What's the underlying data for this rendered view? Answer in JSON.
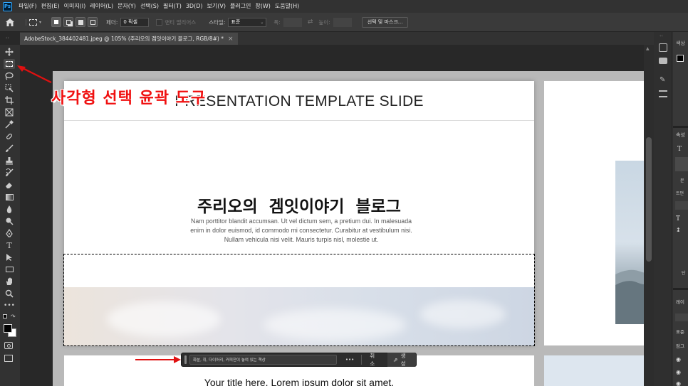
{
  "menubar": {
    "app_icon": "Ps",
    "items": [
      "파일(F)",
      "편집(E)",
      "이미지(I)",
      "레이어(L)",
      "문자(Y)",
      "선택(S)",
      "필터(T)",
      "3D(D)",
      "보기(V)",
      "플러그인",
      "창(W)",
      "도움말(H)"
    ]
  },
  "options": {
    "feather_label": "페더:",
    "feather_value": "0 픽셀",
    "antialias_label": "앤티 앨리어스",
    "style_label": "스타일:",
    "style_value": "표준",
    "width_label": "폭:",
    "height_label": "높이:",
    "select_mask_button": "선택 및 마스크..."
  },
  "document": {
    "tab_title": "AdobeStock_384402481.jpeg @ 105% (주리오의  겜잇이야기  블로그, RGB/8#) *",
    "close_symbol": "×"
  },
  "slide1": {
    "heading": "PRESENTATION TEMPLATE SLIDE",
    "title": "주리오의  겜잇이야기  블로그",
    "body": "Nam porttitor blandit accumsan. Ut vel dictum sem, a pretium dui. In malesuada enim in dolor euismod, id commodo mi consectetur. Curabitur at vestibulum nisi. Nullam vehicula nisi velit. Mauris turpis nisl, molestie ut."
  },
  "slide3": {
    "title": "Your title here. Lorem ipsum dolor sit amet."
  },
  "annotation": {
    "label": "사각형  선택  윤곽  도구"
  },
  "context_bar": {
    "prompt_placeholder": "화분, 쥐, 다이어리, 커피잔이 놓여 있는 책상",
    "more": "•••",
    "cancel": "취소",
    "generate": "생성"
  },
  "right_panel": {
    "color_label": "색상",
    "properties_label": "속성",
    "section2": "문",
    "section2_sub": "트먼",
    "section3": "단",
    "layers_label": "레이",
    "layer_filter": "표준",
    "lock_label": "잠그"
  },
  "colors": {
    "accent": "#31a8ff",
    "annotation_red": "#f01010",
    "selection": "#000000",
    "generate_bg": "#3d3d3d"
  },
  "icons": [
    "home-icon",
    "marquee-icon",
    "move-icon",
    "lasso-icon",
    "crop-icon",
    "eyedropper-icon",
    "brush-icon",
    "stamp-icon",
    "eraser-icon",
    "gradient-icon",
    "pen-icon",
    "type-icon",
    "hand-icon",
    "zoom-icon",
    "more-icon"
  ]
}
